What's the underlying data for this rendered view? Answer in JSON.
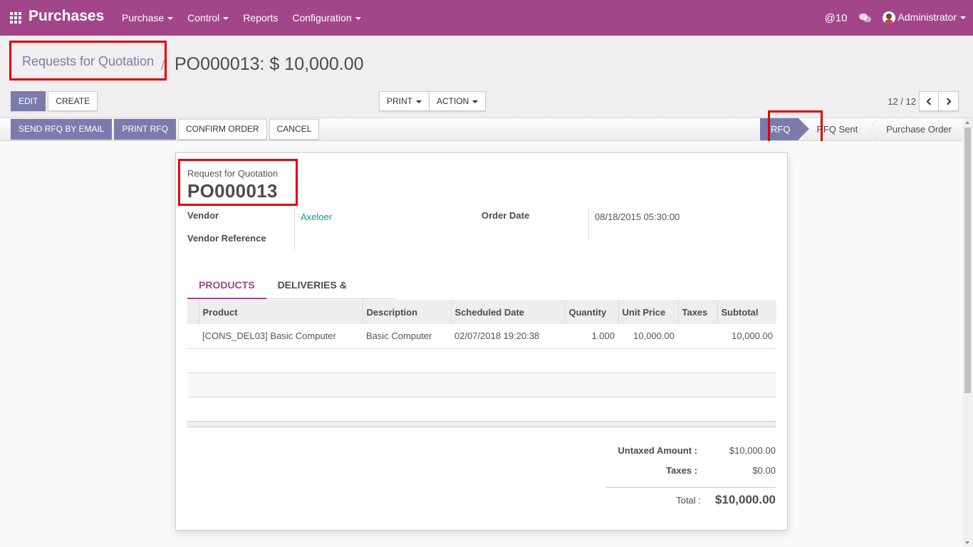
{
  "navbar": {
    "app_title": "Purchases",
    "menu": [
      "Purchase",
      "Control",
      "Reports",
      "Configuration"
    ],
    "mentions": "@10",
    "user": "Administrator",
    "color": "#a24689"
  },
  "control_panel": {
    "breadcrumb": "Requests for Quotation",
    "record_title": "PO000013: $ 10,000.00",
    "buttons": {
      "edit": "EDIT",
      "create": "CREATE",
      "print": "PRINT",
      "action": "ACTION"
    },
    "pager": "12 / 12"
  },
  "statusbar": {
    "actions": {
      "send_rfq": "SEND RFQ BY EMAIL",
      "print_rfq": "PRINT RFQ",
      "confirm": "CONFIRM ORDER",
      "cancel": "Cancel"
    },
    "stages": [
      "RFQ",
      "RFQ Sent",
      "Purchase Order"
    ],
    "active_stage": "RFQ"
  },
  "form": {
    "doc_label": "Request for Quotation",
    "doc_name": "PO000013",
    "fields": {
      "vendor_label": "Vendor",
      "vendor_value": "Axeloer",
      "vendor_ref_label": "Vendor Reference",
      "order_date_label": "Order Date",
      "order_date_value": "08/18/2015 05:30:00"
    },
    "tabs": [
      "PRODUCTS",
      "DELIVERIES & INVOICES"
    ],
    "columns": [
      "Product",
      "Description",
      "Scheduled Date",
      "Quantity",
      "Unit Price",
      "Taxes",
      "Subtotal"
    ],
    "lines": [
      {
        "product": "[CONS_DEL03] Basic Computer",
        "description": "Basic Computer",
        "scheduled": "02/07/2018 19:20:38",
        "qty": "1.000",
        "price": "10,000.00",
        "taxes": "",
        "subtotal": "10,000.00"
      }
    ],
    "totals": {
      "untaxed_label": "Untaxed Amount :",
      "untaxed": "$10,000.00",
      "taxes_label": "Taxes :",
      "taxes": "$0.00",
      "total_label": "Total :",
      "total": "$10,000.00"
    }
  }
}
